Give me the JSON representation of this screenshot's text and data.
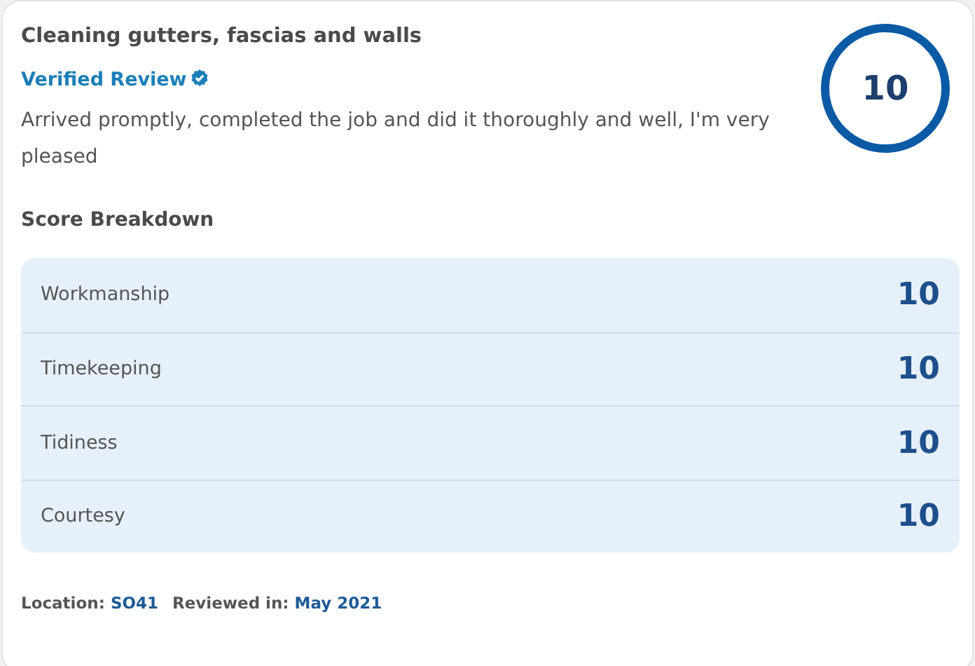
{
  "review": {
    "title": "Cleaning gutters, fascias and walls",
    "verified_label": "Verified Review",
    "text": "Arrived promptly, completed the job and did it thoroughly and well, I'm very pleased",
    "overall_score": "10"
  },
  "breakdown": {
    "heading": "Score Breakdown",
    "rows": [
      {
        "label": "Workmanship",
        "score": "10"
      },
      {
        "label": "Timekeeping",
        "score": "10"
      },
      {
        "label": "Tidiness",
        "score": "10"
      },
      {
        "label": "Courtesy",
        "score": "10"
      }
    ]
  },
  "footer": {
    "location_label": "Location:",
    "location": "SO41",
    "reviewed_label": "Reviewed in:",
    "reviewed": "May 2021"
  }
}
